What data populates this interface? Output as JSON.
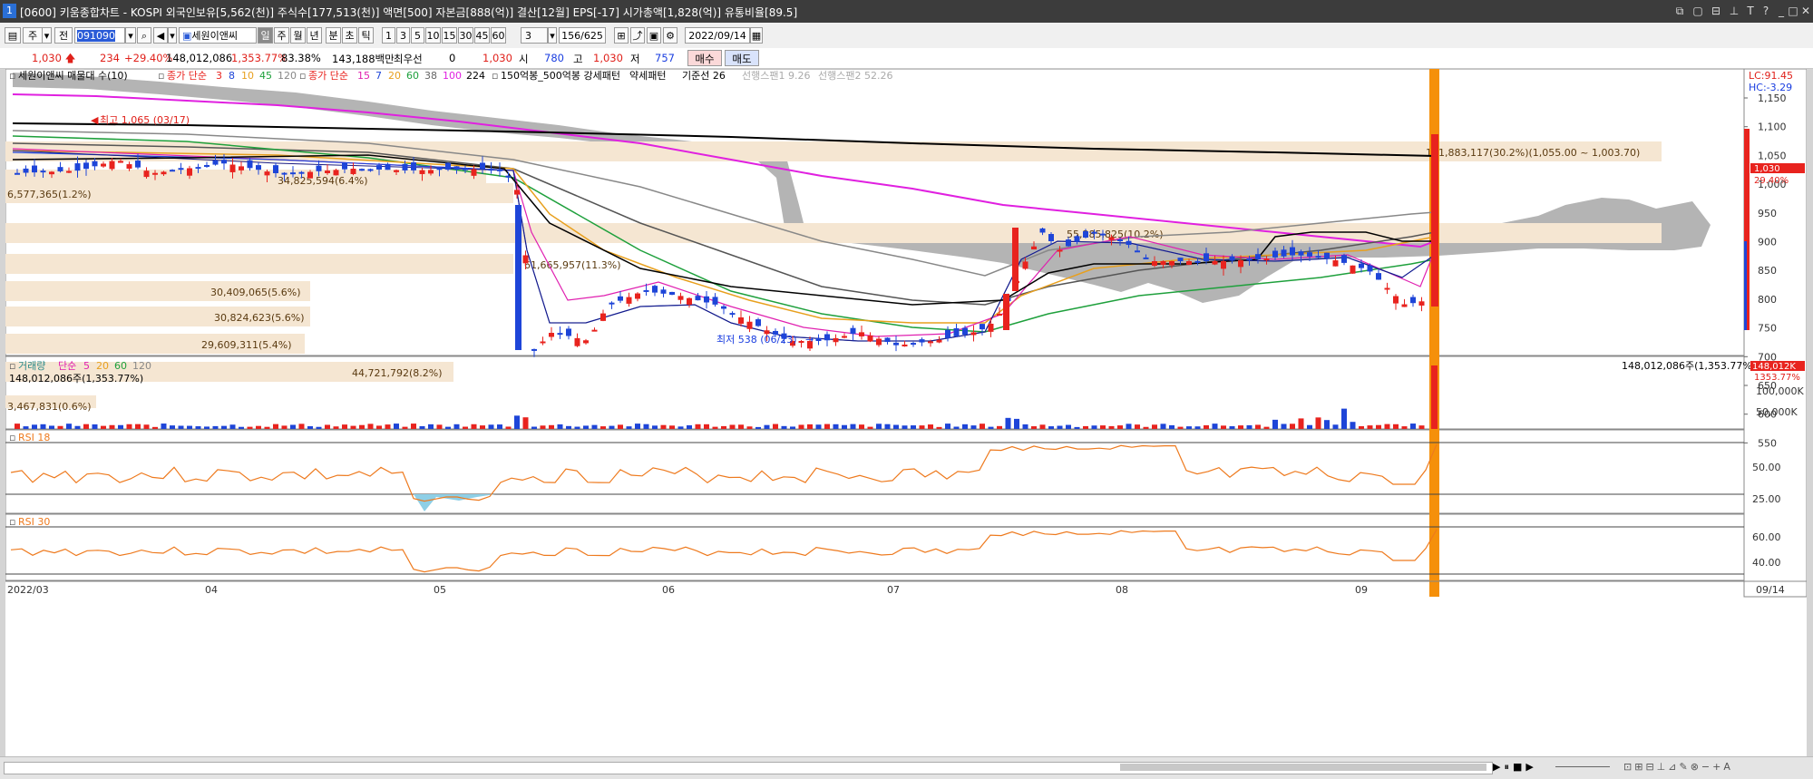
{
  "titlebar": {
    "num": "1",
    "title": "[0600] 키움종합차트 - KOSPI 외국인보유[5,562(천)] 주식수[177,513(천)] 액면[500] 자본금[888(억)] 결산[12월] EPS[-17] 시가총액[1,828(억)] 유통비율[89.5]"
  },
  "toolbar": {
    "type1": "주",
    "type2": "전",
    "code": "091090",
    "stock_name": "세원이앤씨",
    "periods": [
      "일",
      "주",
      "월",
      "년",
      "분",
      "초",
      "틱"
    ],
    "minutes": [
      "1",
      "3",
      "5",
      "10",
      "15",
      "30",
      "45",
      "60"
    ],
    "count_sel": "3",
    "range": "156/625",
    "date": "2022/09/14"
  },
  "infobar": {
    "price": "1,030",
    "change": "234",
    "change_pct": "+29.40%",
    "volume": "148,012,086",
    "vol_ratio": "1,353.77%",
    "turnover": "83.38%",
    "amount": "143,188백만",
    "pref": "최우선",
    "pref_val": "0",
    "cur": "1,030",
    "open_lbl": "시",
    "open": "780",
    "high_lbl": "고",
    "high": "1,030",
    "low_lbl": "저",
    "low": "757",
    "buy": "매수",
    "sell": "매도"
  },
  "legend": {
    "main": "세원이앤씨 매물대 수(10)",
    "ma1_label": "종가 단순",
    "ma1_periods": [
      "3",
      "8",
      "10",
      "45",
      "120"
    ],
    "ma2_label": "종가 단순",
    "ma2_periods": [
      "15",
      "7",
      "20",
      "60",
      "38",
      "100",
      "224"
    ],
    "pattern": "150억봉_500억봉 강세패턴",
    "weak": "약세패턴",
    "base": "기준선 26",
    "span1": "선행스팬1 9.26",
    "span2": "선행스팬2 52.26",
    "lc": "LC:91.45",
    "hc": "HC:-3.29"
  },
  "price_axis": [
    "1,150",
    "1,100",
    "1,050",
    "1,000",
    "950",
    "900",
    "850",
    "800",
    "750",
    "700",
    "650",
    "600",
    "550"
  ],
  "price_tag": {
    "price": "1,030",
    "pct": "29.40%"
  },
  "volume_profile": [
    {
      "label": "181,883,117(30.2%)(1,055.00 ~ 1,003.70)"
    },
    {
      "label": "6,577,365(1.2%)"
    },
    {
      "label": "34,825,594(6.4%)"
    },
    {
      "label": "55,385,825(10.2%)"
    },
    {
      "label": "61,665,957(11.3%)"
    },
    {
      "label": "30,409,065(5.6%)"
    },
    {
      "label": "30,824,623(5.6%)"
    },
    {
      "label": "29,609,311(5.4%)"
    },
    {
      "label": "44,721,792(8.2%)"
    },
    {
      "label": "3,467,831(0.6%)"
    }
  ],
  "annotations": {
    "high": "최고 1,065 (03/17)",
    "low": "최저 538 (06/23)"
  },
  "volume_panel": {
    "legend_vol": "거래량",
    "legend_ma": "단순",
    "ma_periods": [
      "5",
      "20",
      "60",
      "120"
    ],
    "value": "148,012,086주(1,353.77%)",
    "right_value": "148,012,086주(1,353.77%)",
    "axis": [
      "100,000K",
      "50,000K"
    ],
    "tag1": "148,012K",
    "tag2": "1353.77%"
  },
  "rsi18": {
    "label": "RSI 18",
    "axis": [
      "50.00",
      "25.00"
    ]
  },
  "rsi30": {
    "label": "RSI 30",
    "axis": [
      "60.00",
      "40.00"
    ]
  },
  "x_axis": [
    "2022/03",
    "04",
    "05",
    "06",
    "07",
    "08",
    "09"
  ],
  "x_axis_end": "09/14",
  "colors": {
    "up": "#e8231e",
    "down": "#1e45d8",
    "ichimoku": "#b4b4b4",
    "profile": "#f5e6d2",
    "highlight": "#f5900a",
    "rsi": "#ee7a1e"
  }
}
